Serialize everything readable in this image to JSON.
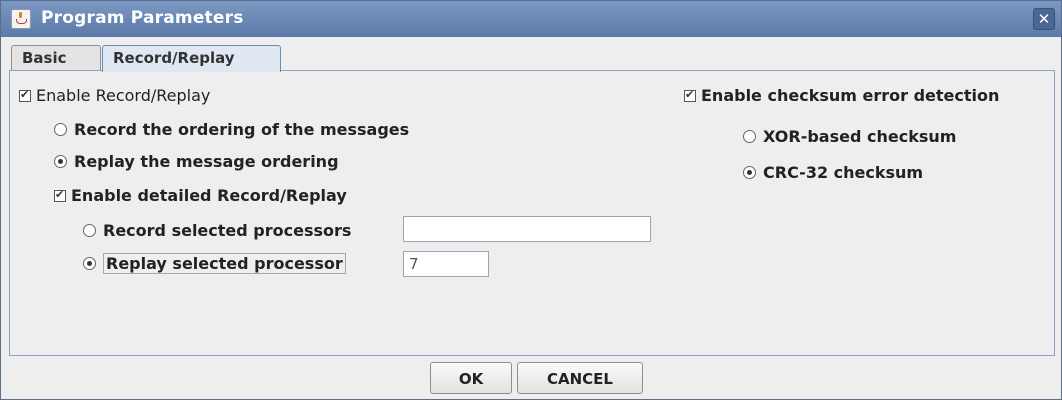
{
  "window": {
    "title": "Program Parameters",
    "close_glyph": "✕"
  },
  "tabs": [
    {
      "label": "Basic",
      "active": false
    },
    {
      "label": "Record/Replay",
      "active": true
    }
  ],
  "record_replay": {
    "enable_label": "Enable Record/Replay",
    "enable_checked": true,
    "record_ordering_label": "Record the ordering of the messages",
    "replay_ordering_label": "Replay the message ordering",
    "ordering_selected": "replay",
    "detailed_label": "Enable detailed Record/Replay",
    "detailed_checked": true,
    "record_selected_label": "Record selected processors",
    "record_selected_value": "",
    "replay_selected_label": "Replay selected processor",
    "replay_selected_value": "7",
    "processor_selected": "replay"
  },
  "checksum": {
    "enable_label": "Enable checksum error detection",
    "enable_checked": true,
    "xor_label": "XOR-based checksum",
    "crc_label": "CRC-32 checksum",
    "selected": "crc"
  },
  "buttons": {
    "ok": "OK",
    "cancel": "CANCEL"
  }
}
